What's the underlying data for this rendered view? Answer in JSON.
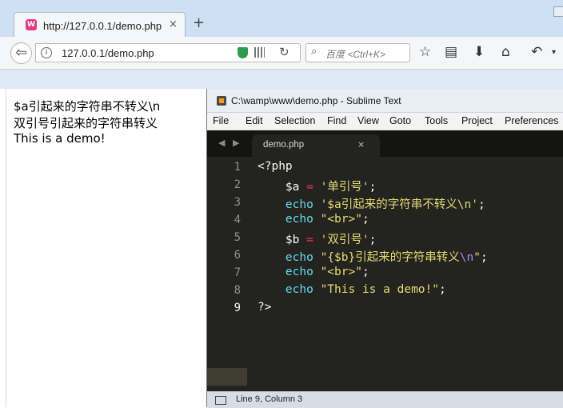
{
  "browser": {
    "tab_title": "http://127.0.0.1/demo.php",
    "tab_favicon_letter": "W",
    "tab_close": "×",
    "new_tab": "+",
    "url": "127.0.0.1/demo.php",
    "search_placeholder": "百度 <Ctrl+K>",
    "icons": {
      "back": "back-arrow-icon",
      "info": "info-icon",
      "shield": "shield-icon",
      "qr": "qr-code-icon",
      "reload": "reload-icon",
      "search": "search-icon",
      "bookmark": "star-icon",
      "reading_list": "clipboard-icon",
      "download": "download-arrow-icon",
      "home": "home-icon",
      "history_back": "undo-arrow-icon",
      "menu": "chevron-down-icon"
    }
  },
  "page": {
    "lines": [
      "$a引起来的字符串不转义\\n",
      "双引号引起来的字符串转义",
      "This is a demo!"
    ]
  },
  "sublime": {
    "title": "C:\\wamp\\www\\demo.php - Sublime Text",
    "menu": [
      "File",
      "Edit",
      "Selection",
      "Find",
      "View",
      "Goto",
      "Tools",
      "Project",
      "Preferences"
    ],
    "tab_label": "demo.php",
    "tab_close": "×",
    "nav_arrows": "◀ ▶",
    "line_numbers": [
      "1",
      "2",
      "3",
      "4",
      "5",
      "6",
      "7",
      "8",
      "9"
    ],
    "active_line": 9,
    "code": {
      "l1": "<?php",
      "l2_var": "$a",
      "l2_op": "=",
      "l2_str": "'单引号'",
      "l2_end": ";",
      "l3_kw": "echo",
      "l3_str": "'$a引起来的字符串不转义\\n'",
      "l3_end": ";",
      "l4_kw": "echo",
      "l4_str": "\"<br>\"",
      "l4_end": ";",
      "l5_var": "$b",
      "l5_op": "=",
      "l5_str": "'双引号'",
      "l5_end": ";",
      "l6_kw": "echo",
      "l6_str_a": "\"{$b}引起来的字符串转义",
      "l6_esc": "\\n",
      "l6_str_b": "\"",
      "l6_end": ";",
      "l7_kw": "echo",
      "l7_str": "\"<br>\"",
      "l7_end": ";",
      "l8_kw": "echo",
      "l8_str": "\"This is a demo!\"",
      "l8_end": ";",
      "l9": "?>"
    },
    "status": "Line 9, Column 3"
  },
  "colors": {
    "editor_bg": "#23241f",
    "keyword": "#66d9ef",
    "string": "#e6db74",
    "operator": "#f92672",
    "escape": "#ae81ff"
  }
}
